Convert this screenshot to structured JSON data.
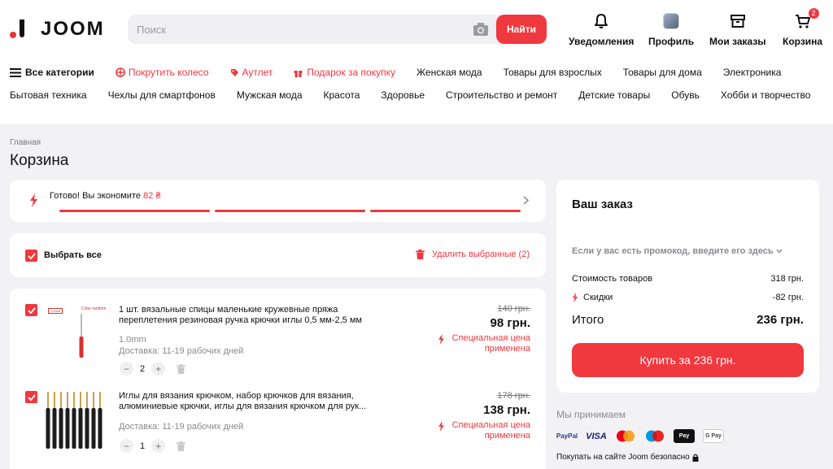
{
  "header": {
    "logo_text": "JOOM",
    "search_placeholder": "Поиск",
    "search_button": "Найти",
    "nav": {
      "notifications": "Уведомления",
      "profile": "Профиль",
      "orders": "Мои заказы",
      "cart": "Корзина",
      "cart_count": "2"
    }
  },
  "categories": {
    "row1": {
      "all": "Все категории",
      "wheel": "Покрутить колесо",
      "outlet": "Аутлет",
      "gift": "Подарок за покупку",
      "items": [
        "Женская мода",
        "Товары для взрослых",
        "Товары для дома",
        "Электроника"
      ]
    },
    "row2": [
      "Бытовая техника",
      "Чехлы для смартфонов",
      "Мужская мода",
      "Красота",
      "Здоровье",
      "Строительство и ремонт",
      "Детские товары",
      "Обувь",
      "Хобби и творчество"
    ]
  },
  "breadcrumb": "Главная",
  "page_title": "Корзина",
  "savings": {
    "text": "Готово! Вы экономите",
    "amount": "82 ₴"
  },
  "select_all": "Выбрать все",
  "delete_selected": "Удалить выбранные (2)",
  "items": [
    {
      "title": "1 шт. вязальные спицы маленькие кружевные пряжа переплетения резиновая ручка крючки иглы 0,5 мм-2,5 мм",
      "variant": "1.0mm",
      "delivery": "Доставка: 11-19 рабочих дней",
      "qty": "2",
      "old_price": "140 грн.",
      "price": "98 грн.",
      "special": "Специальная цена применена",
      "thumb_label_a": "1.0mm",
      "thumb_label_b": "Color random"
    },
    {
      "title": "Иглы для вязания крючком, набор крючков для вязания, алюминиевые крючки, иглы для вязания крючком для рук...",
      "variant": "",
      "delivery": "Доставка: 11-19 рабочих дней",
      "qty": "1",
      "old_price": "178 грн.",
      "price": "138 грн.",
      "special": "Специальная цена применена"
    }
  ],
  "order": {
    "title": "Ваш заказ",
    "promo": "Если у вас есть промокод, введите его здесь",
    "goods_label": "Стоимость товаров",
    "goods_value": "318 грн.",
    "discount_label": "Скидки",
    "discount_value": "-82 грн.",
    "total_label": "Итого",
    "total_value": "236 грн.",
    "buy_button": "Купить за 236 грн."
  },
  "payment": {
    "title": "Мы принимаем",
    "methods": [
      "PayPal",
      "VISA",
      "",
      "",
      "Pay",
      "G Pay"
    ],
    "secure": "Покупать на сайте Joom безопасно"
  },
  "colors": {
    "accent": "#f0383f",
    "background": "#f2f2f4"
  }
}
